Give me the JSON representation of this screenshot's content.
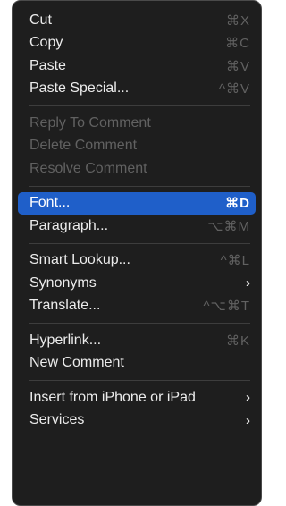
{
  "menu": {
    "items": [
      {
        "label": "Cut",
        "shortcut": "⌘X"
      },
      {
        "label": "Copy",
        "shortcut": "⌘C"
      },
      {
        "label": "Paste",
        "shortcut": "⌘V"
      },
      {
        "label": "Paste Special...",
        "shortcut": "^⌘V"
      },
      {
        "label": "Reply To Comment"
      },
      {
        "label": "Delete Comment"
      },
      {
        "label": "Resolve Comment"
      },
      {
        "label": "Font...",
        "shortcut": "⌘D"
      },
      {
        "label": "Paragraph...",
        "shortcut": "⌥⌘M"
      },
      {
        "label": "Smart Lookup...",
        "shortcut": "^⌘L"
      },
      {
        "label": "Synonyms",
        "submenu_icon": "chevron-right-icon"
      },
      {
        "label": "Translate...",
        "shortcut": "^⌥⌘T"
      },
      {
        "label": "Hyperlink...",
        "shortcut": "⌘K"
      },
      {
        "label": "New Comment"
      },
      {
        "label": "Insert from iPhone or iPad",
        "submenu_icon": "chevron-right-icon"
      },
      {
        "label": "Services",
        "submenu_icon": "chevron-right-icon"
      }
    ],
    "highlighted_item": "Font...",
    "colors": {
      "background": "#1e1e1e",
      "highlight": "#1f5fc9",
      "text": "#ececec",
      "disabled_text": "#616161"
    }
  }
}
